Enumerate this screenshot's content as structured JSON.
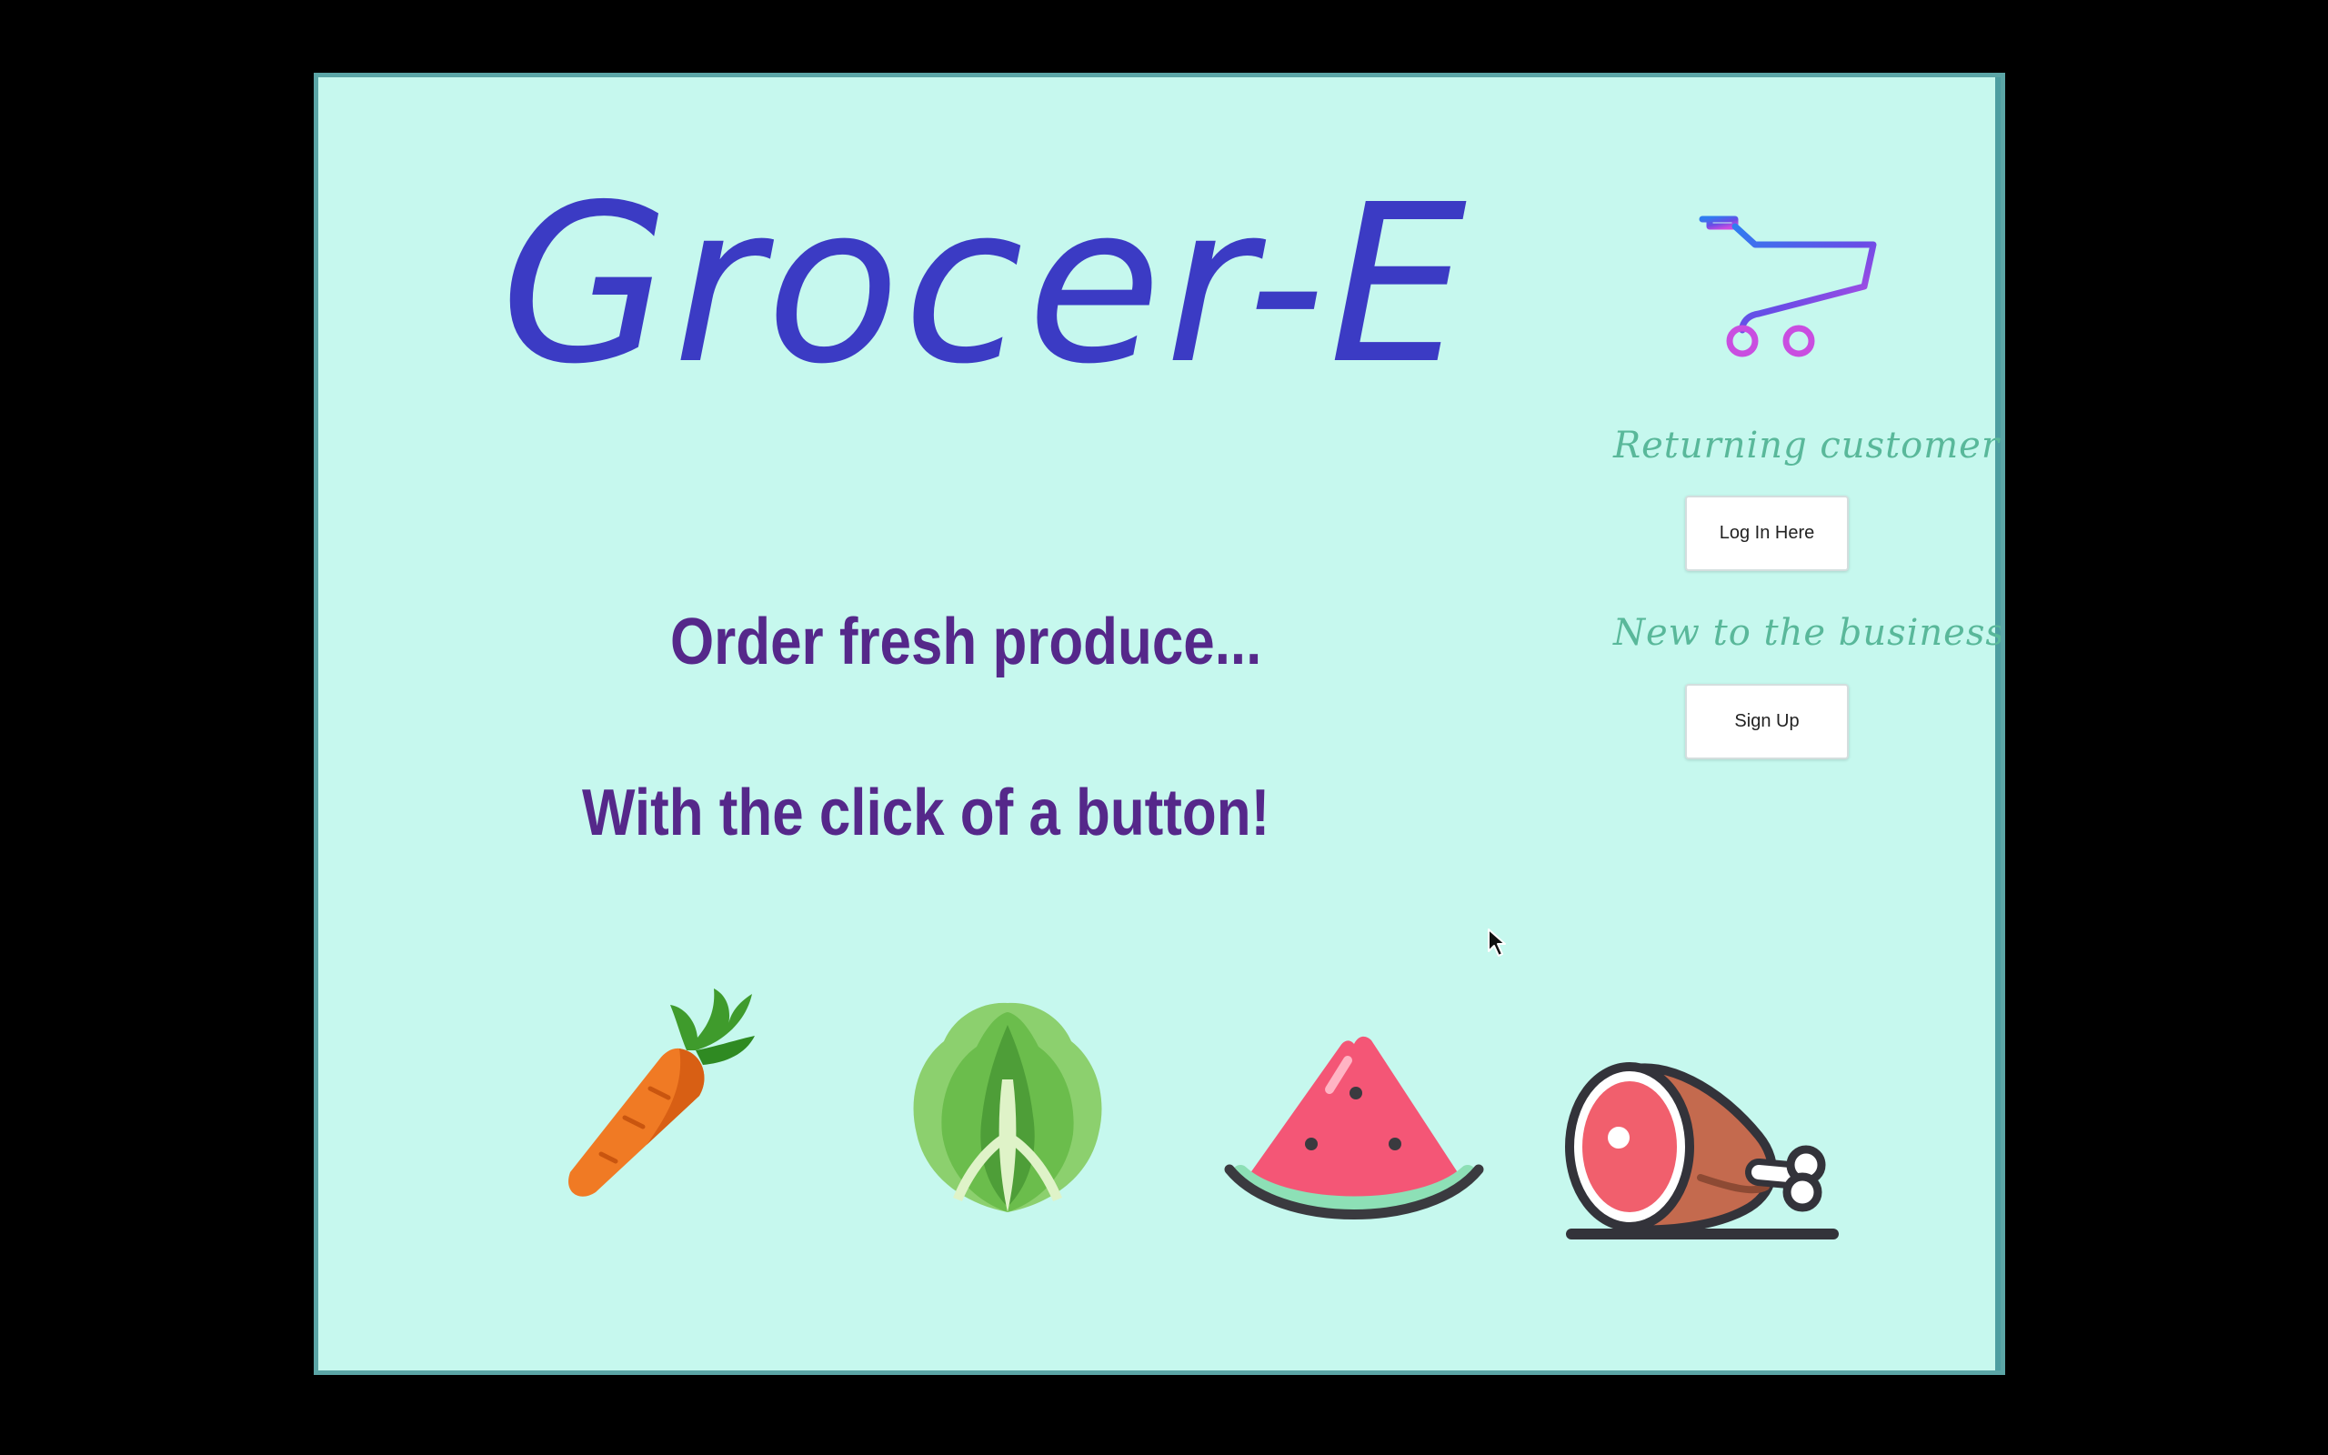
{
  "app": {
    "title": "Grocer-E",
    "tagline_line1": "Order fresh produce...",
    "tagline_line2": "With the click of a button!"
  },
  "auth": {
    "returning_label": "Returning customer?",
    "login_button": "Log In Here",
    "new_label": "New to the business?",
    "signup_button": "Sign Up"
  },
  "icons": {
    "cart": "shopping-cart-icon",
    "produce": [
      "carrot-icon",
      "lettuce-icon",
      "watermelon-icon",
      "ham-icon"
    ],
    "cursor": "mouse-pointer-icon"
  },
  "colors": {
    "background": "#c6f8ee",
    "frame_border": "#5ba5a6",
    "title": "#3b3bc4",
    "tagline": "#55288a",
    "side_label": "#59b89a"
  }
}
